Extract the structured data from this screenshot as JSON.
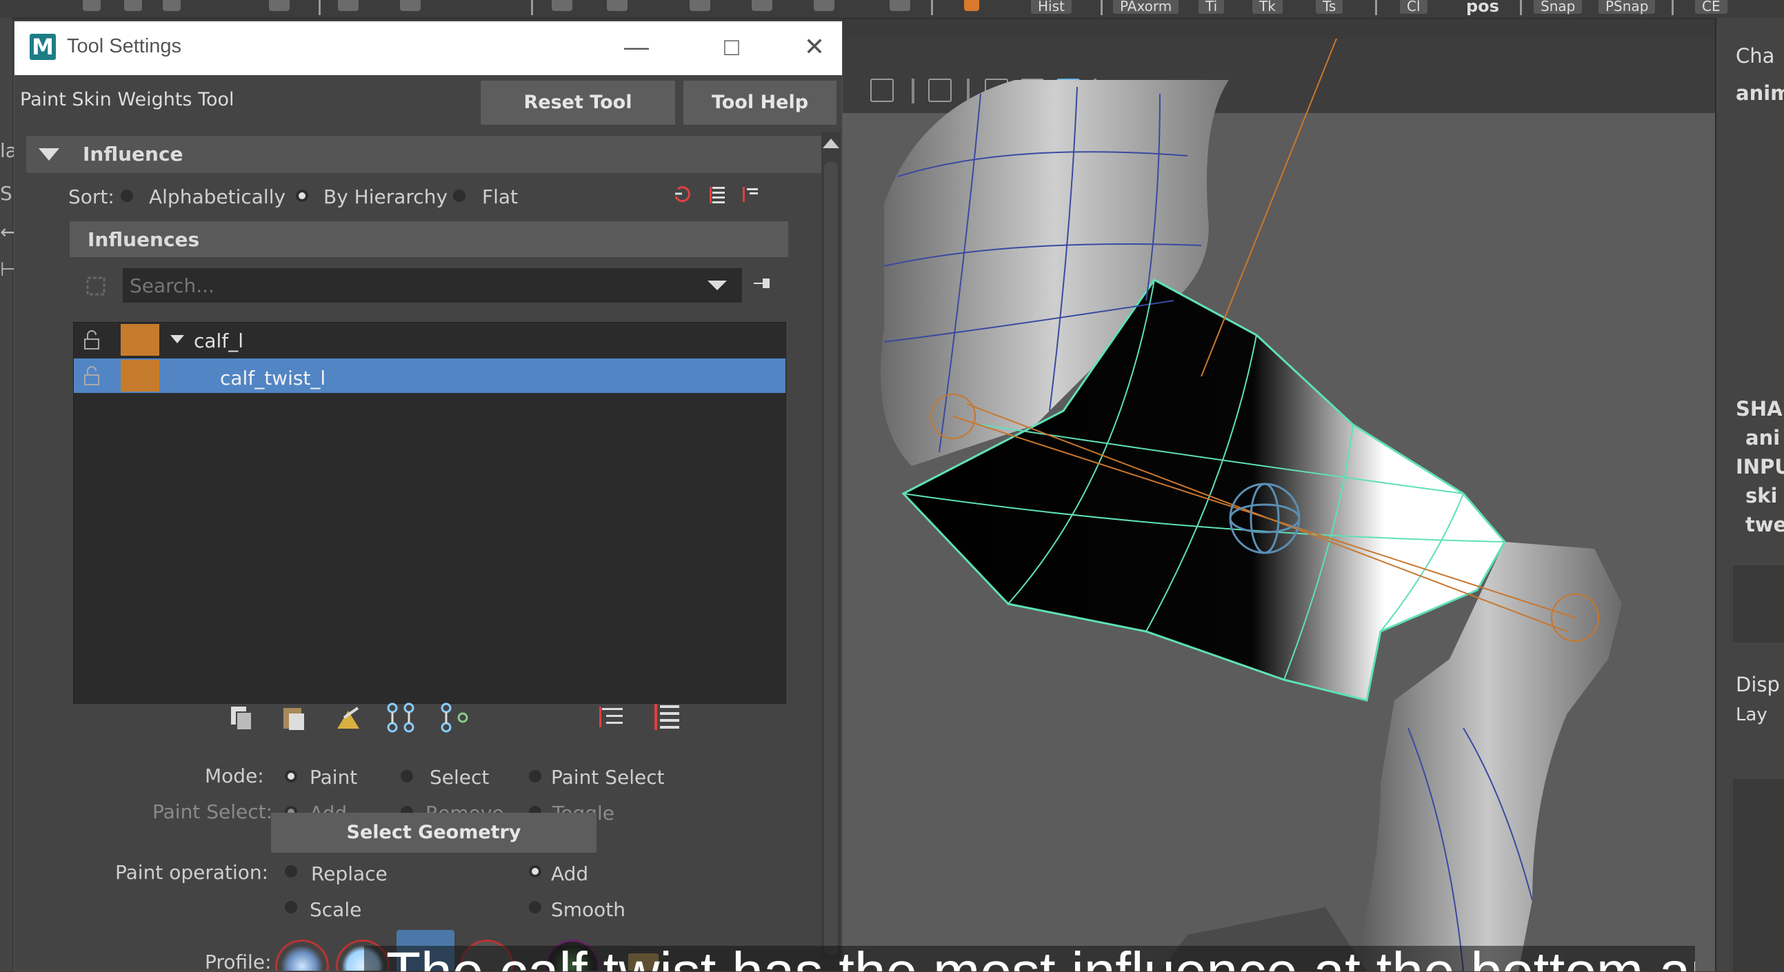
{
  "window": {
    "title": "Tool Settings",
    "logo": "M",
    "minimize": "—",
    "maximize": "□",
    "close": "✕"
  },
  "tool": {
    "name": "Paint Skin Weights Tool",
    "reset_label": "Reset Tool",
    "help_label": "Tool Help"
  },
  "influence_section": {
    "title": "Influence",
    "sort_label": "Sort:",
    "sort_options": [
      "Alphabetically",
      "By Hierarchy",
      "Flat"
    ],
    "sort_selected": "By Hierarchy",
    "influences_header": "Influences",
    "search_placeholder": "Search...",
    "tree": [
      {
        "label": "calf_l",
        "color": "#c67c2c",
        "expanded": true,
        "selected": false
      },
      {
        "label": "calf_twist_l",
        "color": "#c67c2c",
        "selected": true
      }
    ]
  },
  "mode": {
    "label": "Mode:",
    "options": [
      "Paint",
      "Select",
      "Paint Select"
    ],
    "selected": "Paint"
  },
  "paint_select": {
    "label": "Paint Select:",
    "options": [
      "Add",
      "Remove",
      "Toggle"
    ],
    "selected": "Add"
  },
  "select_geometry_label": "Select Geometry",
  "paint_operation": {
    "label": "Paint operation:",
    "options": [
      "Replace",
      "Add",
      "Scale",
      "Smooth"
    ],
    "selected": "Add"
  },
  "profile_label": "Profile:",
  "topbar": {
    "buttons": [
      "Hist",
      "PAxorm",
      "Ti",
      "Tk",
      "Ts",
      "Cl",
      "pos",
      "Snap",
      "PSnap",
      "CE"
    ]
  },
  "channel_box": {
    "lines": [
      "Cha",
      "anim",
      "SHAP",
      "ani",
      "INPU",
      "ski",
      "twe",
      "Disp",
      "Lay"
    ]
  },
  "subtitle": "The calf twist has the most influence at the bottom and"
}
